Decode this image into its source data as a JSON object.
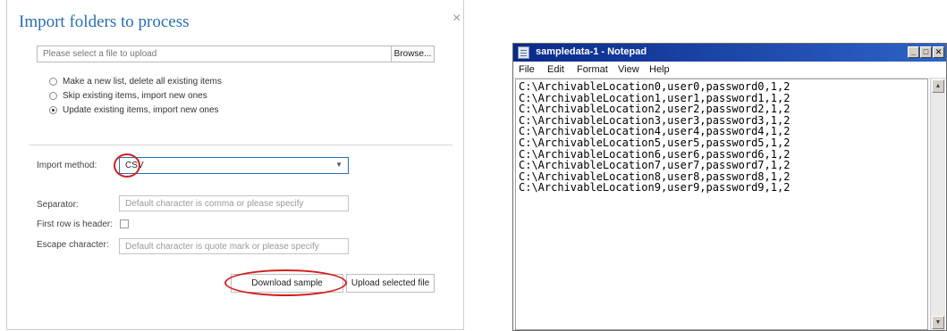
{
  "dialog": {
    "title": "Import folders to process",
    "close_glyph": "×",
    "file_placeholder": "Please select a file to upload",
    "browse_label": "Browse...",
    "options": [
      {
        "label": "Make a new list, delete all existing items",
        "checked": false
      },
      {
        "label": "Skip existing items, import new ones",
        "checked": false
      },
      {
        "label": "Update existing items, import new ones",
        "checked": true
      }
    ],
    "import_method_label": "Import method:",
    "import_method_value": "CSV",
    "separator_label": "Separator:",
    "separator_placeholder": "Default character is comma or please specify",
    "first_row_label": "First row is header:",
    "escape_label": "Escape character:",
    "escape_placeholder": "Default character is quote mark or please specify",
    "download_label": "Download sample",
    "upload_label": "Upload selected file",
    "annotation_color": "#d21f1f"
  },
  "notepad": {
    "title": "sampledata-1 - Notepad",
    "menu": [
      "File",
      "Edit",
      "Format",
      "View",
      "Help"
    ],
    "lines": [
      "C:\\ArchivableLocation0,user0,password0,1,2",
      "C:\\ArchivableLocation1,user1,password1,1,2",
      "C:\\ArchivableLocation2,user2,password2,1,2",
      "C:\\ArchivableLocation3,user3,password3,1,2",
      "C:\\ArchivableLocation4,user4,password4,1,2",
      "C:\\ArchivableLocation5,user5,password5,1,2",
      "C:\\ArchivableLocation6,user6,password6,1,2",
      "C:\\ArchivableLocation7,user7,password7,1,2",
      "C:\\ArchivableLocation8,user8,password8,1,2",
      "C:\\ArchivableLocation9,user9,password9,1,2"
    ],
    "title_bar_color": "#0a2a8a"
  }
}
